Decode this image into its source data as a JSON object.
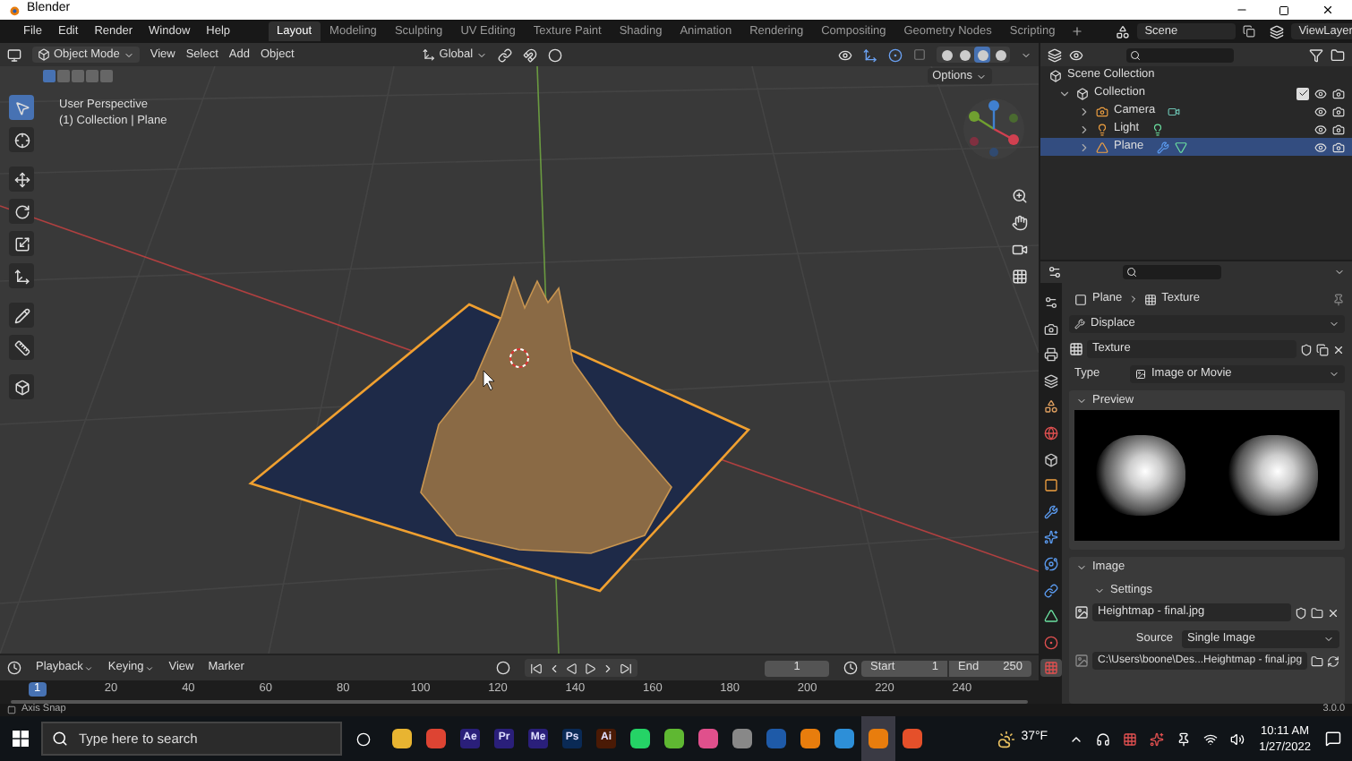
{
  "window": {
    "title": "Blender"
  },
  "menu": [
    "File",
    "Edit",
    "Render",
    "Window",
    "Help"
  ],
  "workspaces": [
    {
      "label": "Layout",
      "selected": true
    },
    {
      "label": "Modeling",
      "selected": false
    },
    {
      "label": "Sculpting",
      "selected": false
    },
    {
      "label": "UV Editing",
      "selected": false
    },
    {
      "label": "Texture Paint",
      "selected": false
    },
    {
      "label": "Shading",
      "selected": false
    },
    {
      "label": "Animation",
      "selected": false
    },
    {
      "label": "Rendering",
      "selected": false
    },
    {
      "label": "Compositing",
      "selected": false
    },
    {
      "label": "Geometry Nodes",
      "selected": false
    },
    {
      "label": "Scripting",
      "selected": false
    }
  ],
  "scene": "Scene",
  "view_layer": "ViewLayer",
  "viewport": {
    "mode": "Object Mode",
    "menus": [
      "View",
      "Select",
      "Add",
      "Object"
    ],
    "orientation": "Global",
    "options": "Options",
    "overlay_text": [
      "User Perspective",
      "(1) Collection | Plane"
    ],
    "shading": [
      {
        "selected": false
      },
      {
        "selected": false
      },
      {
        "selected": true
      },
      {
        "selected": false
      }
    ],
    "select_modes": [
      {
        "selected": true
      },
      {
        "selected": false
      },
      {
        "selected": false
      },
      {
        "selected": false
      },
      {
        "selected": false
      }
    ],
    "tools": [
      {
        "kind": "select",
        "selected": true
      },
      {
        "kind": "cursor",
        "selected": false
      },
      {
        "kind": "move",
        "selected": false
      },
      {
        "kind": "rotate",
        "selected": false
      },
      {
        "kind": "scale",
        "selected": false
      },
      {
        "kind": "transform",
        "selected": false
      },
      {
        "kind": "annotate",
        "selected": false
      },
      {
        "kind": "measure",
        "selected": false
      },
      {
        "kind": "add",
        "selected": false
      }
    ]
  },
  "outliner": {
    "root": "Scene Collection",
    "items": [
      {
        "label": "Collection",
        "expanded": true,
        "checked": true,
        "children": [
          {
            "label": "Camera",
            "kind": "camera",
            "expanded": false,
            "selected": false
          },
          {
            "label": "Light",
            "kind": "light",
            "expanded": false,
            "selected": false
          },
          {
            "label": "Plane",
            "kind": "mesh",
            "expanded": false,
            "selected": true
          }
        ]
      }
    ]
  },
  "properties": {
    "tabs": [
      {
        "kind": "tool",
        "selected": false
      },
      {
        "kind": "render",
        "selected": false
      },
      {
        "kind": "output",
        "selected": false
      },
      {
        "kind": "view_layer",
        "selected": false
      },
      {
        "kind": "scene",
        "selected": false
      },
      {
        "kind": "world",
        "selected": false
      },
      {
        "kind": "collection",
        "selected": false
      },
      {
        "kind": "object",
        "selected": false
      },
      {
        "kind": "modifiers",
        "selected": false
      },
      {
        "kind": "particles",
        "selected": false
      },
      {
        "kind": "physics",
        "selected": false
      },
      {
        "kind": "constraints",
        "selected": false
      },
      {
        "kind": "data",
        "selected": false
      },
      {
        "kind": "material",
        "selected": false
      },
      {
        "kind": "texture",
        "selected": true
      }
    ],
    "breadcrumb": [
      "Plane",
      "Texture"
    ],
    "modifier": "Displace",
    "texture": "Texture",
    "type_label": "Type",
    "type_value": "Image or Movie",
    "preview": {
      "title": "Preview",
      "expanded": true
    },
    "image": {
      "title": "Image",
      "expanded": true
    },
    "settings": {
      "title": "Settings",
      "expanded": true
    },
    "image_name": "Heightmap - final.jpg",
    "source_label": "Source",
    "source_value": "Single Image",
    "filepath": "C:\\Users\\boone\\Des...Heightmap - final.jpg"
  },
  "timeline": {
    "menus": [
      "Playback",
      "Keying",
      "View",
      "Marker"
    ],
    "current_frame": "1",
    "start_label": "Start",
    "start": "1",
    "end_label": "End",
    "end": "250",
    "playhead": "1",
    "ticks": [
      "20",
      "40",
      "60",
      "80",
      "100",
      "120",
      "140",
      "160",
      "180",
      "200",
      "220",
      "240"
    ]
  },
  "status": {
    "hint": "Axis Snap",
    "version": "3.0.0"
  },
  "taskbar": {
    "search_placeholder": "Type here to search",
    "apps": [
      {
        "kind": "tile",
        "color": "#e8b431",
        "selected": false
      },
      {
        "kind": "tile",
        "color": "#dd4433",
        "selected": false
      },
      {
        "kind": "letters",
        "text": "Ae",
        "color": "#2a1f7a",
        "selected": false
      },
      {
        "kind": "letters",
        "text": "Pr",
        "color": "#2a1f7a",
        "selected": false
      },
      {
        "kind": "letters",
        "text": "Me",
        "color": "#2a1f7a",
        "selected": false
      },
      {
        "kind": "letters",
        "text": "Ps",
        "color": "#0a2a55",
        "selected": false
      },
      {
        "kind": "letters",
        "text": "Ai",
        "color": "#4a1a05",
        "selected": false
      },
      {
        "kind": "tile",
        "color": "#25d366",
        "selected": false
      },
      {
        "kind": "tile",
        "color": "#5fb832",
        "selected": false
      },
      {
        "kind": "tile",
        "color": "#e0508c",
        "selected": false
      },
      {
        "kind": "tile",
        "color": "#888888",
        "selected": false
      },
      {
        "kind": "tile",
        "color": "#1e5aa8",
        "selected": false
      },
      {
        "kind": "tile",
        "color": "#e87d0d",
        "selected": false
      },
      {
        "kind": "tile",
        "color": "#2d8fd8",
        "selected": false
      },
      {
        "kind": "tile",
        "color": "#e87d0d",
        "selected": true
      },
      {
        "kind": "tile",
        "color": "#e5502a",
        "selected": false
      }
    ],
    "weather": "37°F",
    "time": "10:11 AM",
    "date": "1/27/2022"
  }
}
